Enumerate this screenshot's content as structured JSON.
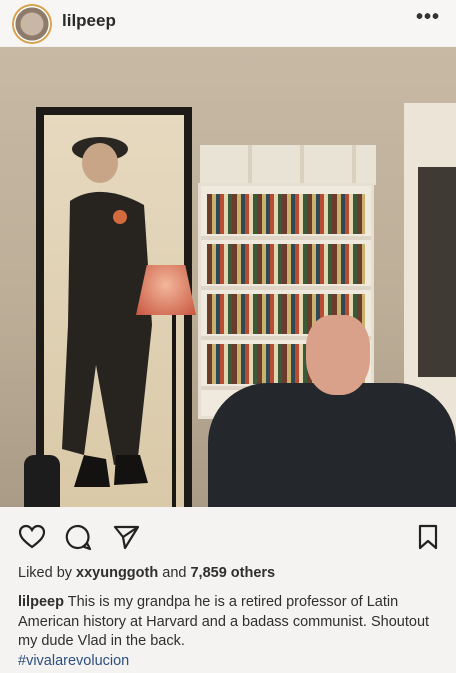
{
  "post": {
    "username": "lilpeep",
    "more_label": "•••",
    "likes": {
      "prefix": "Liked by",
      "user": "xxyunggoth",
      "middle": "and",
      "count_text": "7,859 others"
    },
    "caption": {
      "author": "lilpeep",
      "text": "This is my grandpa he is a retired professor of Latin American history at Harvard and a badass communist. Shoutout my dude Vlad in the back.",
      "hashtag": "#vivalarevolucion"
    }
  },
  "icons": {
    "like": "heart-icon",
    "comment": "comment-icon",
    "share": "send-icon",
    "save": "bookmark-icon"
  },
  "colors": {
    "background": "#f4f3f1",
    "hashtag": "#2d4f7d",
    "text": "#2f2f2f"
  }
}
